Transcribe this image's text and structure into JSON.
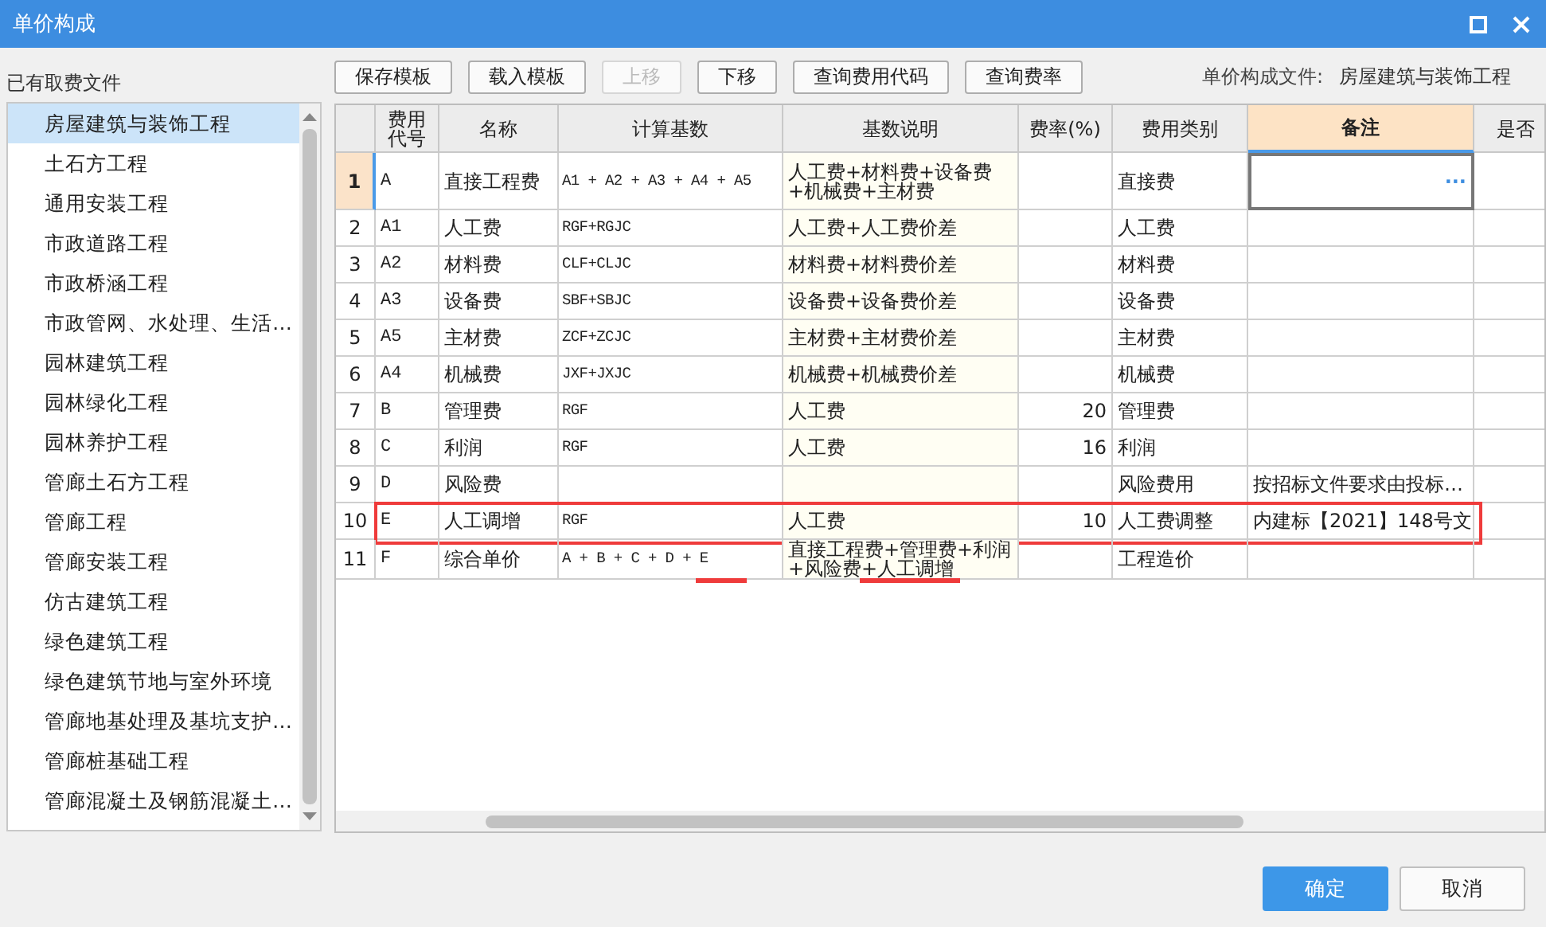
{
  "window": {
    "title": "单价构成"
  },
  "left_panel": {
    "label": "已有取费文件",
    "items": [
      {
        "label": "房屋建筑与装饰工程",
        "selected": true
      },
      {
        "label": "土石方工程",
        "selected": false
      },
      {
        "label": "通用安装工程",
        "selected": false
      },
      {
        "label": "市政道路工程",
        "selected": false
      },
      {
        "label": "市政桥涵工程",
        "selected": false
      },
      {
        "label": "市政管网、水处理、生活…",
        "selected": false
      },
      {
        "label": "园林建筑工程",
        "selected": false
      },
      {
        "label": "园林绿化工程",
        "selected": false
      },
      {
        "label": "园林养护工程",
        "selected": false
      },
      {
        "label": "管廊土石方工程",
        "selected": false
      },
      {
        "label": "管廊工程",
        "selected": false
      },
      {
        "label": "管廊安装工程",
        "selected": false
      },
      {
        "label": "仿古建筑工程",
        "selected": false
      },
      {
        "label": "绿色建筑工程",
        "selected": false
      },
      {
        "label": "绿色建筑节地与室外环境",
        "selected": false
      },
      {
        "label": "管廊地基处理及基坑支护…",
        "selected": false
      },
      {
        "label": "管廊桩基础工程",
        "selected": false
      },
      {
        "label": "管廊混凝土及钢筋混凝土…",
        "selected": false
      }
    ]
  },
  "toolbar": [
    {
      "label": "保存模板",
      "disabled": false
    },
    {
      "label": "载入模板",
      "disabled": false
    },
    {
      "label": "上移",
      "disabled": true
    },
    {
      "label": "下移",
      "disabled": false
    },
    {
      "label": "查询费用代码",
      "disabled": false
    },
    {
      "label": "查询费率",
      "disabled": false
    }
  ],
  "file_info": {
    "label": "单价构成文件:",
    "value": "房屋建筑与装饰工程"
  },
  "table": {
    "columns": [
      {
        "selected": false
      },
      {
        "label": "费用代号",
        "selected": false
      },
      {
        "label": "名称",
        "selected": false
      },
      {
        "label": "计算基数",
        "selected": false
      },
      {
        "label": "基数说明",
        "selected": false
      },
      {
        "label": "费率(%)",
        "selected": false
      },
      {
        "label": "费用类别",
        "selected": false
      },
      {
        "label": "备注",
        "selected": true
      },
      {
        "label": "是否",
        "selected": false
      }
    ],
    "edit_button": "···",
    "rows": [
      {
        "index": "1",
        "code": "A",
        "name": "直接工程费",
        "formula": "A1 + A2 + A3 + A4 + A5",
        "desc": "人工费+材料费+设备费+机械费+主材费",
        "rate": "",
        "category": "直接费",
        "note": "",
        "selected": true,
        "highlighted": false
      },
      {
        "index": "2",
        "code": "A1",
        "name": "人工费",
        "formula": "RGF+RGJC",
        "desc": "人工费+人工费价差",
        "rate": "",
        "category": "人工费",
        "note": "",
        "selected": false,
        "highlighted": false
      },
      {
        "index": "3",
        "code": "A2",
        "name": "材料费",
        "formula": "CLF+CLJC",
        "desc": "材料费+材料费价差",
        "rate": "",
        "category": "材料费",
        "note": "",
        "selected": false,
        "highlighted": false
      },
      {
        "index": "4",
        "code": "A3",
        "name": "设备费",
        "formula": "SBF+SBJC",
        "desc": "设备费+设备费价差",
        "rate": "",
        "category": "设备费",
        "note": "",
        "selected": false,
        "highlighted": false
      },
      {
        "index": "5",
        "code": "A5",
        "name": "主材费",
        "formula": "ZCF+ZCJC",
        "desc": "主材费+主材费价差",
        "rate": "",
        "category": "主材费",
        "note": "",
        "selected": false,
        "highlighted": false
      },
      {
        "index": "6",
        "code": "A4",
        "name": "机械费",
        "formula": "JXF+JXJC",
        "desc": "机械费+机械费价差",
        "rate": "",
        "category": "机械费",
        "note": "",
        "selected": false,
        "highlighted": false
      },
      {
        "index": "7",
        "code": "B",
        "name": "管理费",
        "formula": "RGF",
        "desc": "人工费",
        "rate": "20",
        "category": "管理费",
        "note": "",
        "selected": false,
        "highlighted": false
      },
      {
        "index": "8",
        "code": "C",
        "name": "利润",
        "formula": "RGF",
        "desc": "人工费",
        "rate": "16",
        "category": "利润",
        "note": "",
        "selected": false,
        "highlighted": false
      },
      {
        "index": "9",
        "code": "D",
        "name": "风险费",
        "formula": "",
        "desc": "",
        "rate": "",
        "category": "风险费用",
        "note": "按招标文件要求由投标…",
        "selected": false,
        "highlighted": false
      },
      {
        "index": "10",
        "code": "E",
        "name": "人工调增",
        "formula": "RGF",
        "desc": "人工费",
        "rate": "10",
        "category": "人工费调整",
        "note": "内建标【2021】148号文",
        "selected": false,
        "highlighted": true
      },
      {
        "index": "11",
        "code": "F",
        "name": "综合单价",
        "formula": "A + B + C + D + E",
        "desc": "直接工程费+管理费+利润+风险费+人工调增",
        "rate": "",
        "category": "工程造价",
        "note": "",
        "selected": false,
        "highlighted": false
      }
    ]
  },
  "buttons": [
    {
      "label": "确定",
      "primary": true
    },
    {
      "label": "取消",
      "primary": false
    }
  ]
}
